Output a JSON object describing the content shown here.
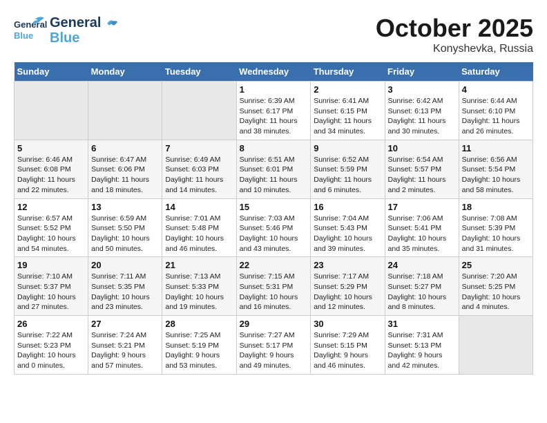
{
  "header": {
    "logo_general": "General",
    "logo_blue": "Blue",
    "month": "October 2025",
    "location": "Konyshevka, Russia"
  },
  "weekdays": [
    "Sunday",
    "Monday",
    "Tuesday",
    "Wednesday",
    "Thursday",
    "Friday",
    "Saturday"
  ],
  "weeks": [
    [
      {
        "day": "",
        "empty": true
      },
      {
        "day": "",
        "empty": true
      },
      {
        "day": "",
        "empty": true
      },
      {
        "day": "1",
        "sunrise": "6:39 AM",
        "sunset": "6:17 PM",
        "daylight": "11 hours and 38 minutes."
      },
      {
        "day": "2",
        "sunrise": "6:41 AM",
        "sunset": "6:15 PM",
        "daylight": "11 hours and 34 minutes."
      },
      {
        "day": "3",
        "sunrise": "6:42 AM",
        "sunset": "6:13 PM",
        "daylight": "11 hours and 30 minutes."
      },
      {
        "day": "4",
        "sunrise": "6:44 AM",
        "sunset": "6:10 PM",
        "daylight": "11 hours and 26 minutes."
      }
    ],
    [
      {
        "day": "5",
        "sunrise": "6:46 AM",
        "sunset": "6:08 PM",
        "daylight": "11 hours and 22 minutes."
      },
      {
        "day": "6",
        "sunrise": "6:47 AM",
        "sunset": "6:06 PM",
        "daylight": "11 hours and 18 minutes."
      },
      {
        "day": "7",
        "sunrise": "6:49 AM",
        "sunset": "6:03 PM",
        "daylight": "11 hours and 14 minutes."
      },
      {
        "day": "8",
        "sunrise": "6:51 AM",
        "sunset": "6:01 PM",
        "daylight": "11 hours and 10 minutes."
      },
      {
        "day": "9",
        "sunrise": "6:52 AM",
        "sunset": "5:59 PM",
        "daylight": "11 hours and 6 minutes."
      },
      {
        "day": "10",
        "sunrise": "6:54 AM",
        "sunset": "5:57 PM",
        "daylight": "11 hours and 2 minutes."
      },
      {
        "day": "11",
        "sunrise": "6:56 AM",
        "sunset": "5:54 PM",
        "daylight": "10 hours and 58 minutes."
      }
    ],
    [
      {
        "day": "12",
        "sunrise": "6:57 AM",
        "sunset": "5:52 PM",
        "daylight": "10 hours and 54 minutes."
      },
      {
        "day": "13",
        "sunrise": "6:59 AM",
        "sunset": "5:50 PM",
        "daylight": "10 hours and 50 minutes."
      },
      {
        "day": "14",
        "sunrise": "7:01 AM",
        "sunset": "5:48 PM",
        "daylight": "10 hours and 46 minutes."
      },
      {
        "day": "15",
        "sunrise": "7:03 AM",
        "sunset": "5:46 PM",
        "daylight": "10 hours and 43 minutes."
      },
      {
        "day": "16",
        "sunrise": "7:04 AM",
        "sunset": "5:43 PM",
        "daylight": "10 hours and 39 minutes."
      },
      {
        "day": "17",
        "sunrise": "7:06 AM",
        "sunset": "5:41 PM",
        "daylight": "10 hours and 35 minutes."
      },
      {
        "day": "18",
        "sunrise": "7:08 AM",
        "sunset": "5:39 PM",
        "daylight": "10 hours and 31 minutes."
      }
    ],
    [
      {
        "day": "19",
        "sunrise": "7:10 AM",
        "sunset": "5:37 PM",
        "daylight": "10 hours and 27 minutes."
      },
      {
        "day": "20",
        "sunrise": "7:11 AM",
        "sunset": "5:35 PM",
        "daylight": "10 hours and 23 minutes."
      },
      {
        "day": "21",
        "sunrise": "7:13 AM",
        "sunset": "5:33 PM",
        "daylight": "10 hours and 19 minutes."
      },
      {
        "day": "22",
        "sunrise": "7:15 AM",
        "sunset": "5:31 PM",
        "daylight": "10 hours and 16 minutes."
      },
      {
        "day": "23",
        "sunrise": "7:17 AM",
        "sunset": "5:29 PM",
        "daylight": "10 hours and 12 minutes."
      },
      {
        "day": "24",
        "sunrise": "7:18 AM",
        "sunset": "5:27 PM",
        "daylight": "10 hours and 8 minutes."
      },
      {
        "day": "25",
        "sunrise": "7:20 AM",
        "sunset": "5:25 PM",
        "daylight": "10 hours and 4 minutes."
      }
    ],
    [
      {
        "day": "26",
        "sunrise": "7:22 AM",
        "sunset": "5:23 PM",
        "daylight": "10 hours and 0 minutes."
      },
      {
        "day": "27",
        "sunrise": "7:24 AM",
        "sunset": "5:21 PM",
        "daylight": "9 hours and 57 minutes."
      },
      {
        "day": "28",
        "sunrise": "7:25 AM",
        "sunset": "5:19 PM",
        "daylight": "9 hours and 53 minutes."
      },
      {
        "day": "29",
        "sunrise": "7:27 AM",
        "sunset": "5:17 PM",
        "daylight": "9 hours and 49 minutes."
      },
      {
        "day": "30",
        "sunrise": "7:29 AM",
        "sunset": "5:15 PM",
        "daylight": "9 hours and 46 minutes."
      },
      {
        "day": "31",
        "sunrise": "7:31 AM",
        "sunset": "5:13 PM",
        "daylight": "9 hours and 42 minutes."
      },
      {
        "day": "",
        "empty": true
      }
    ]
  ],
  "labels": {
    "sunrise_prefix": "Sunrise:",
    "sunset_prefix": "Sunset:",
    "daylight_prefix": "Daylight:"
  }
}
